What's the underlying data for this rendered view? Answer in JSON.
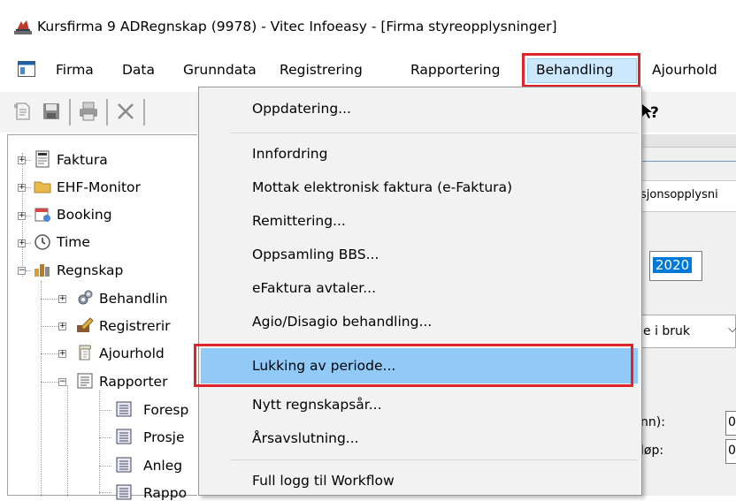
{
  "window": {
    "title": "Kursfirma  9 ADRegnskap (9978) - Vitec Infoeasy - [Firma styreopplysninger]"
  },
  "menubar": {
    "items": [
      "Firma",
      "Data",
      "Grunndata",
      "Registrering",
      "Rapportering",
      "Behandling",
      "Ajourhold"
    ],
    "active": "Behandling"
  },
  "dropdown": {
    "items": [
      "Oppdatering...",
      "Innfordring",
      "Mottak elektronisk faktura (e-Faktura)",
      "Remittering...",
      "Oppsamling BBS...",
      "eFaktura avtaler...",
      "Agio/Disagio behandling...",
      "Lukking av periode...",
      "Nytt regnskapsår...",
      "Årsavslutning...",
      "Full logg til Workflow"
    ],
    "highlighted": "Lukking av periode..."
  },
  "tree": {
    "items": [
      {
        "label": "Faktura"
      },
      {
        "label": "EHF-Monitor"
      },
      {
        "label": "Booking"
      },
      {
        "label": "Time"
      },
      {
        "label": "Regnskap"
      },
      {
        "label": "Behandlin"
      },
      {
        "label": "Registrerir"
      },
      {
        "label": "Ajourhold"
      },
      {
        "label": "Rapporter"
      },
      {
        "label": "Foresp"
      },
      {
        "label": "Prosje"
      },
      {
        "label": "Anleg"
      },
      {
        "label": "Rappo"
      }
    ]
  },
  "right_panel": {
    "tab_label": "sjonsopplysni",
    "year_value": "2020",
    "dropdown_value": "e i bruk",
    "label_1": "nn):",
    "label_2": "løp:",
    "field_1": "0",
    "field_2": "0"
  },
  "colors": {
    "highlight_red": "#e0242c",
    "hover_blue": "#91c9f7",
    "menu_active_bg": "#cce8ff",
    "selection_blue": "#0078d7"
  },
  "icons": [
    "app-icon",
    "new-document-icon",
    "save-icon",
    "print-icon",
    "delete-icon",
    "help-icon",
    "invoice-icon",
    "folder-icon",
    "booking-icon",
    "clock-icon",
    "accounting-icon",
    "gears-icon",
    "edit-icon",
    "maintenance-icon",
    "report-icon",
    "list-doc-icon"
  ]
}
